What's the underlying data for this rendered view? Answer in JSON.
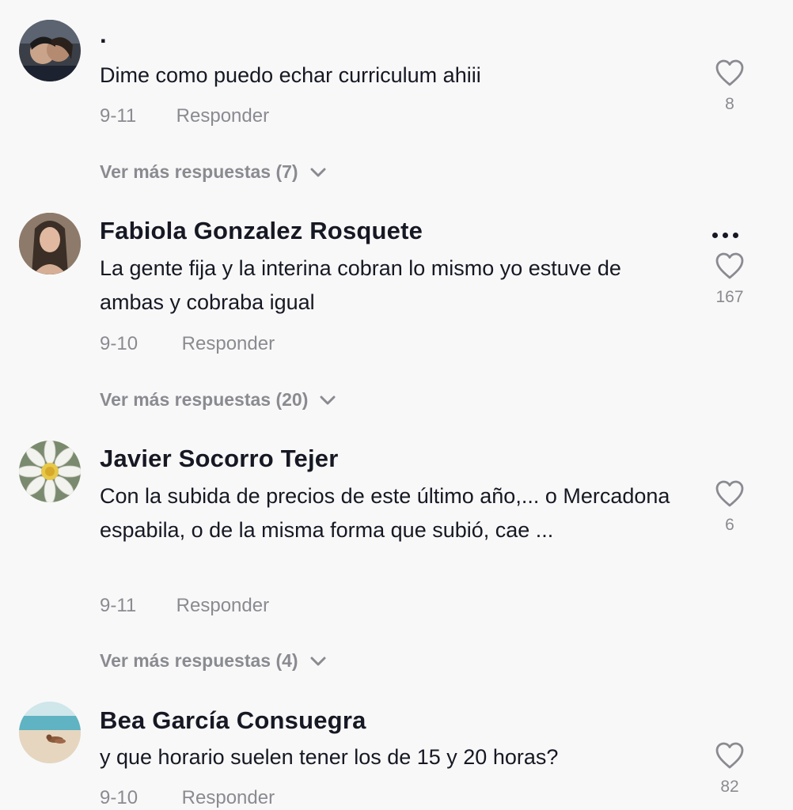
{
  "comments": [
    {
      "username": "·",
      "text": "Dime como puedo echar curriculum ahiii",
      "date": "9-11",
      "reply_label": "Responder",
      "likes": "8",
      "more_replies": "Ver más respuestas (7)"
    },
    {
      "username": "Fabiola Gonzalez Rosquete",
      "text": "La gente fija y la interina cobran lo mismo yo estuve de ambas y cobraba igual",
      "date": "9-10",
      "reply_label": "Responder",
      "likes": "167",
      "more_replies": "Ver más respuestas (20)"
    },
    {
      "username": "Javier Socorro Tejer",
      "text": "Con la subida de precios de este último año,... o Mercadona espabila, o de la misma forma que subió, cae ...",
      "date": "9-11",
      "reply_label": "Responder",
      "likes": "6",
      "more_replies": "Ver más respuestas (4)"
    },
    {
      "username": "Bea García Consuegra",
      "text": "y que horario suelen tener los de 15 y 20 horas?",
      "date": "9-10",
      "reply_label": "Responder",
      "likes": "82"
    }
  ],
  "icons": {
    "like": "heart-outline-icon",
    "expand": "chevron-down-icon",
    "options": "more-options-icon"
  },
  "colors": {
    "background": "#f8f8f8",
    "text_primary": "#161823",
    "text_secondary": "#8a8b91"
  }
}
